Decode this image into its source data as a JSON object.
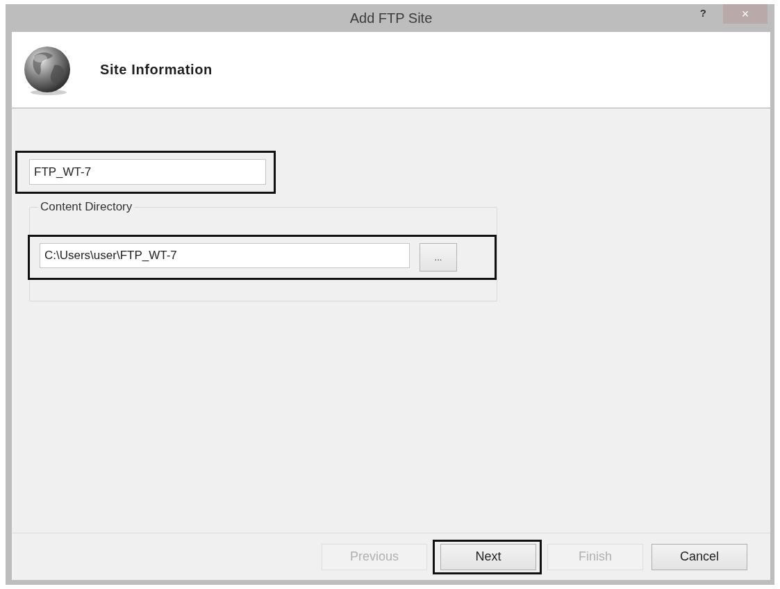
{
  "window": {
    "title": "Add FTP Site",
    "help": "?",
    "close": "×"
  },
  "header": {
    "title": "Site Information"
  },
  "site_name": {
    "value": "FTP_WT-7",
    "highlighted": true
  },
  "content_directory": {
    "label": "Content Directory",
    "physical_path": {
      "value": "C:\\Users\\user\\FTP_WT-7",
      "highlighted": true
    },
    "browse": "..."
  },
  "buttons": [
    {
      "label": "Previous",
      "disabled": true,
      "highlighted": false
    },
    {
      "label": "Next",
      "disabled": false,
      "highlighted": true
    },
    {
      "label": "Finish",
      "disabled": true,
      "highlighted": false
    },
    {
      "label": "Cancel",
      "disabled": false,
      "highlighted": false
    }
  ]
}
